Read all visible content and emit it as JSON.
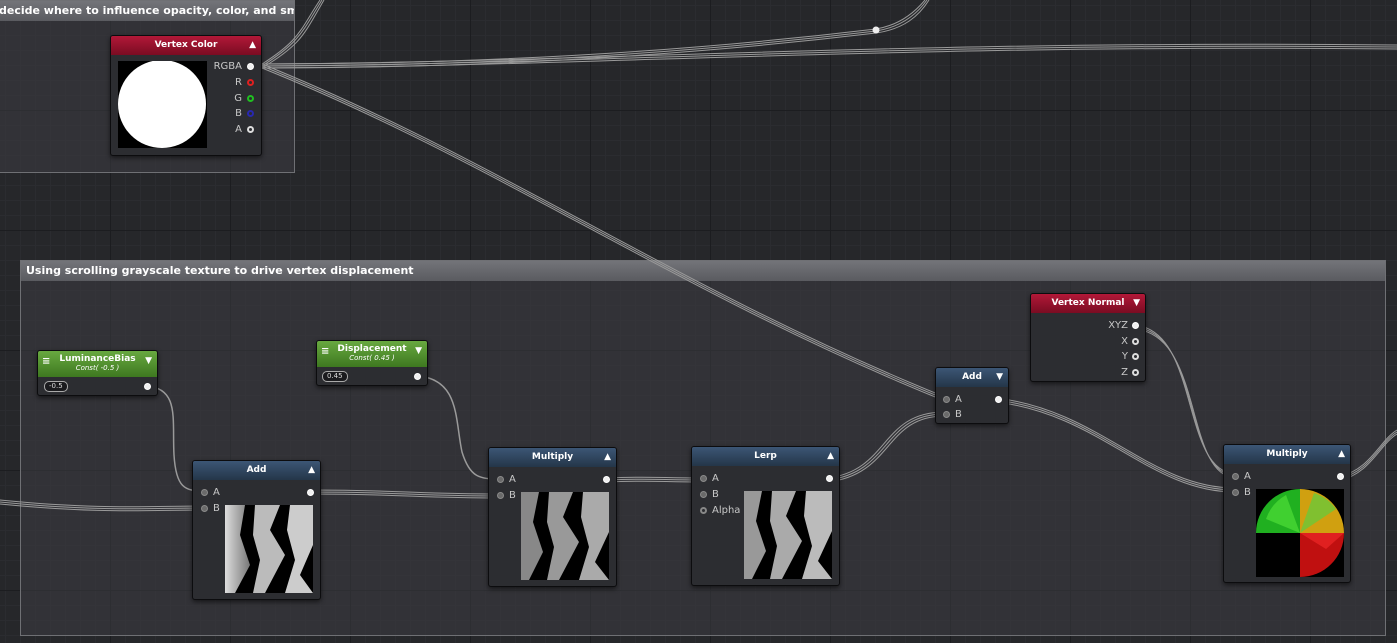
{
  "comments": {
    "top_title": "decide where to influence opacity, color, and smoot",
    "bottom_title": "Using scrolling grayscale texture to drive vertex displacement"
  },
  "vertex_color": {
    "title": "Vertex Color",
    "outputs": [
      "RGBA",
      "R",
      "G",
      "B",
      "A"
    ]
  },
  "vertex_normal": {
    "title": "Vertex Normal",
    "outputs": [
      "XYZ",
      "X",
      "Y",
      "Z"
    ]
  },
  "luminance_bias": {
    "title": "LuminanceBias",
    "subtitle": "Const( -0.5 )",
    "value": "-0.5"
  },
  "displacement": {
    "title": "Displacement",
    "subtitle": "Const( 0.45 )",
    "value": "0.45"
  },
  "add_left": {
    "title": "Add",
    "inputs": [
      "A",
      "B"
    ]
  },
  "multiply_mid": {
    "title": "Multiply",
    "inputs": [
      "A",
      "B"
    ]
  },
  "lerp": {
    "title": "Lerp",
    "inputs": [
      "A",
      "B",
      "Alpha"
    ]
  },
  "add_right": {
    "title": "Add",
    "inputs": [
      "A",
      "B"
    ]
  },
  "multiply_right": {
    "title": "Multiply",
    "inputs": [
      "A",
      "B"
    ]
  },
  "colors": {
    "header_red": "#9c1230",
    "header_blue": "#2f4760",
    "header_green": "#559530",
    "pin_r": "#e02020",
    "pin_g": "#20c020",
    "pin_b": "#2020c0"
  }
}
